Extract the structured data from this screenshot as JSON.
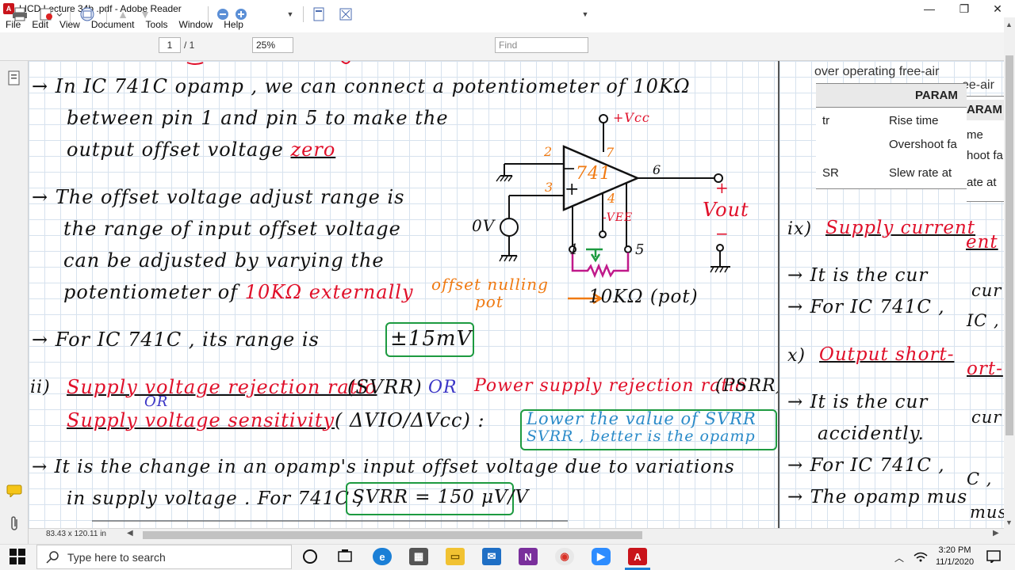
{
  "window": {
    "title": "LICD Lecture 34b .pdf - Adobe Reader",
    "app_icon": "pdf-icon"
  },
  "menu": [
    "File",
    "Edit",
    "View",
    "Document",
    "Tools",
    "Window",
    "Help"
  ],
  "toolbar": {
    "page_current": "1",
    "page_total": "/ 1",
    "zoom": "25%",
    "find_placeholder": "Find"
  },
  "status": {
    "page_size": "83.43 x 120.11 in"
  },
  "taskbar": {
    "search_placeholder": "Type here to search",
    "time": "3:20 PM",
    "date": "11/1/2020"
  },
  "notes": {
    "l1": "→ In IC 741C opamp , we can connect a potentiometer of 10KΩ",
    "l2": "between pin 1 and pin 5 to make the",
    "l3a": "output offset voltage",
    "l3b": "zero",
    "l4": "→ The offset voltage adjust range is",
    "l5": "the range of input offset voltage",
    "l6": "can be adjusted by varying the",
    "l7a": "potentiometer of",
    "l7b": "10KΩ externally",
    "l8": "→ For IC 741C , its range is",
    "range_box": "±15mV",
    "ii": "ii)",
    "svrr_a": "Supply voltage rejection ratio",
    "svrr_b": "(SVRR)",
    "or1": "OR",
    "psrr_a": "Power supply rejection ratio",
    "psrr_b": "(PSRR)",
    "or2": "OR",
    "svs_a": "Supply voltage sensitivity",
    "svs_b": "( ΔVIO/ΔVcc) :",
    "note1": "Lower the value of SVRR",
    "note2": "SVRR , better is the opamp",
    "l9": "→ It is the change in an opamp's input offset voltage due to variations",
    "l10": "in supply voltage . For 741C ,",
    "svrr_box": "SVRR = 150 μV/V"
  },
  "circuit": {
    "vcc": "+Vcc",
    "vee": "-VEE",
    "chip": "741",
    "pin2": "2",
    "pin3": "3",
    "pin7": "7",
    "pin6": "6",
    "pin4": "4",
    "pin1": "1",
    "pin5": "5",
    "minus": "−",
    "plus": "+",
    "vin": "0V",
    "vout": "Vout",
    "vout_plus": "+",
    "vout_minus": "−",
    "pot_label1": "offset nulling",
    "pot_label2": "pot",
    "pot_value": "10KΩ (pot)"
  },
  "right_panel": {
    "header": "over operating free-air",
    "header_dup": "ee-air",
    "table_head": "PARAM",
    "table_head_dup": "ARAM",
    "rows": [
      {
        "sym": "tr",
        "name": "Rise time",
        "dup": "me"
      },
      {
        "sym": "",
        "name": "Overshoot fa",
        "dup": "hoot fa"
      },
      {
        "sym": "SR",
        "name": "Slew rate at",
        "dup": "ate at"
      }
    ],
    "ix": "ix)",
    "ix_title": "Supply current",
    "ix_dup": "ent",
    "r1": "→ It is the cur",
    "r1_dup": "cur",
    "r2": "→ For IC 741C ,",
    "r2_dup": "IC ,",
    "x": "x)",
    "x_title": "Output short-",
    "x_dup": "ort-",
    "r3": "→ It is the cur",
    "r3_dup": "cur",
    "r4": "accidently.",
    "r5": "→ For IC 741C ,",
    "r5_dup": "C ,",
    "r6": "→ The opamp mus",
    "r6_dup": "mus"
  },
  "colors": {
    "red": "#e0102a",
    "blue": "#3a35c6",
    "orange": "#f07a12",
    "green_box": "#1d9a40"
  }
}
